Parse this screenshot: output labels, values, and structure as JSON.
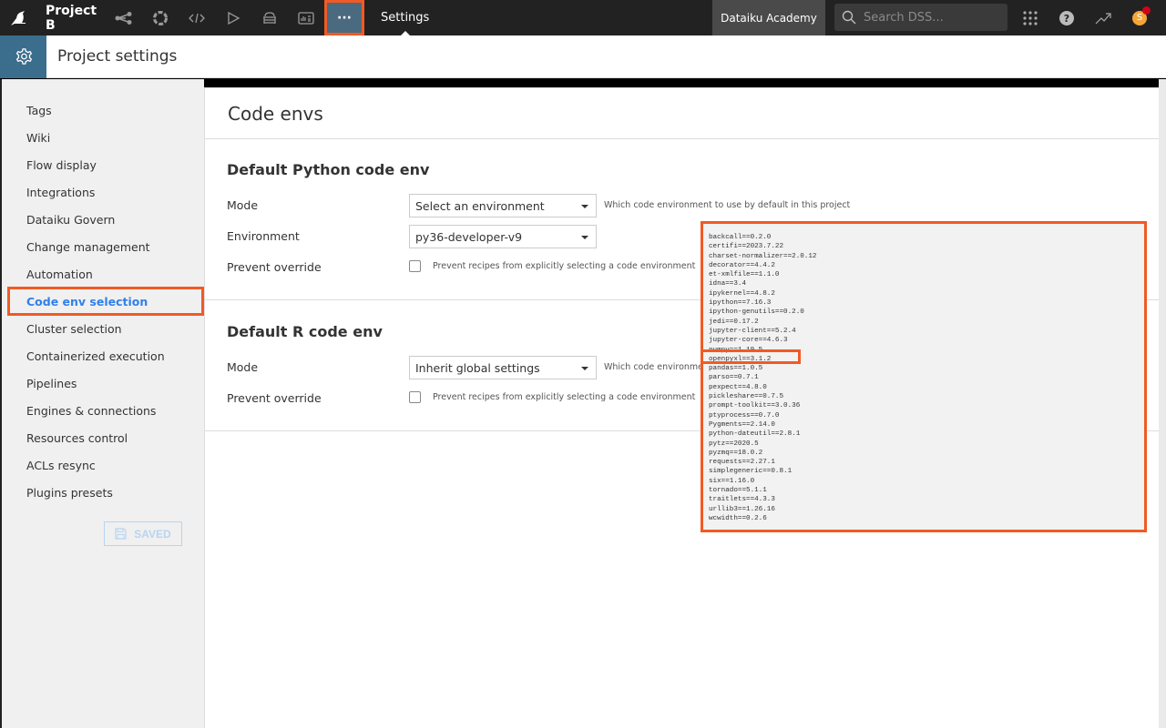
{
  "topbar": {
    "project_name": "Project B",
    "nav_icons": [
      "flow-icon",
      "lab-icon",
      "code-icon",
      "run-icon",
      "stack-icon",
      "dashboard-icon",
      "more-icon"
    ],
    "more_label": "···",
    "current_section": "Settings",
    "academy_label": "Dataiku Academy",
    "search_placeholder": "Search DSS...",
    "avatar_initial": "S"
  },
  "subheader": {
    "title": "Project settings"
  },
  "sidebar": {
    "items": [
      {
        "label": "Tags"
      },
      {
        "label": "Wiki"
      },
      {
        "label": "Flow display"
      },
      {
        "label": "Integrations"
      },
      {
        "label": "Dataiku Govern"
      },
      {
        "label": "Change management"
      },
      {
        "label": "Automation"
      },
      {
        "label": "Code env selection",
        "active": true
      },
      {
        "label": "Cluster selection"
      },
      {
        "label": "Containerized execution"
      },
      {
        "label": "Pipelines"
      },
      {
        "label": "Engines & connections"
      },
      {
        "label": "Resources control"
      },
      {
        "label": "ACLs resync"
      },
      {
        "label": "Plugins presets"
      }
    ],
    "saved_label": "SAVED"
  },
  "main": {
    "title": "Code envs",
    "python": {
      "heading": "Default Python code env",
      "mode_label": "Mode",
      "mode_value": "Select an environment",
      "mode_help": "Which code environment to use by default in this project",
      "env_label": "Environment",
      "env_value": "py36-developer-v9",
      "prevent_label": "Prevent override",
      "prevent_text": "Prevent recipes from explicitly selecting a code environment"
    },
    "r": {
      "heading": "Default R code env",
      "mode_label": "Mode",
      "mode_value": "Inherit global settings",
      "mode_help": "Which code environmen",
      "prevent_label": "Prevent override",
      "prevent_text": "Prevent recipes from explicitly selecting a code environment"
    }
  },
  "packages": [
    "backcall==0.2.0",
    "certifi==2023.7.22",
    "charset-normalizer==2.0.12",
    "decorator==4.4.2",
    "et-xmlfile==1.1.0",
    "idna==3.4",
    "ipykernel==4.8.2",
    "ipython==7.16.3",
    "ipython-genutils==0.2.0",
    "jedi==0.17.2",
    "jupyter-client==5.2.4",
    "jupyter-core==4.6.3",
    "numpy==1.19.5",
    "openpyxl==3.1.2",
    "pandas==1.0.5",
    "parso==0.7.1",
    "pexpect==4.8.0",
    "pickleshare==0.7.5",
    "prompt-toolkit==3.0.36",
    "ptyprocess==0.7.0",
    "Pygments==2.14.0",
    "python-dateutil==2.8.1",
    "pytz==2020.5",
    "pyzmq==18.0.2",
    "requests==2.27.1",
    "simplegeneric==0.8.1",
    "six==1.16.0",
    "tornado==5.1.1",
    "traitlets==4.3.3",
    "urllib3==1.26.16",
    "wcwidth==0.2.6"
  ],
  "highlighted_package": "openpyxl==3.1.2",
  "colors": {
    "accent": "#f15a24",
    "active_link": "#2f80ed",
    "topbar": "#222222",
    "gear_box": "#3b6d8c"
  }
}
